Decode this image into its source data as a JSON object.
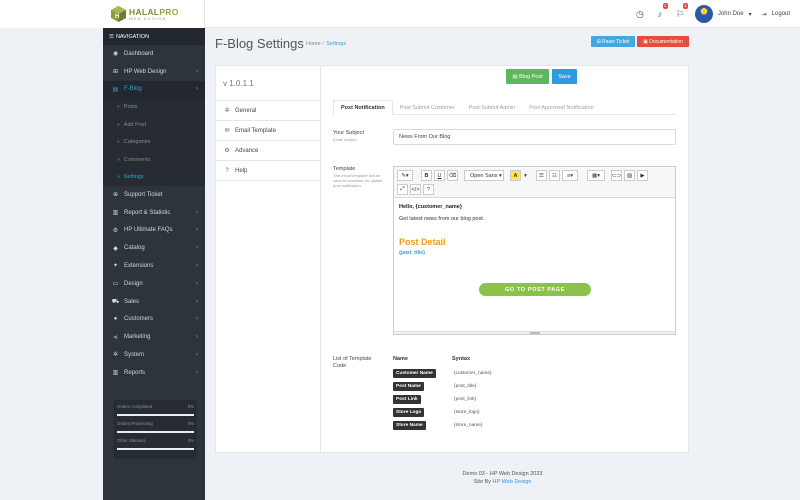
{
  "brand": {
    "name_a": "HALAL",
    "name_b": "PRO",
    "sub": "WEB DESIGN"
  },
  "topbar": {
    "badge1": "3",
    "badge2": "3",
    "user_name": "John Doe",
    "logout": "Logout"
  },
  "sidebar": {
    "heading": "NAVIGATION",
    "items": [
      {
        "label": "Dashboard",
        "icon": "dashboard-icon"
      },
      {
        "label": "HP Web Design",
        "icon": "windows-icon"
      },
      {
        "label": "F-Blog",
        "icon": "blog-icon"
      }
    ],
    "sub_items": [
      "Posts",
      "Add Post",
      "Categories",
      "Comments",
      "Settings"
    ],
    "items2": [
      {
        "label": "Support Ticket"
      },
      {
        "label": "Report & Statistic"
      },
      {
        "label": "HP Ultimate FAQs"
      },
      {
        "label": "Catalog"
      },
      {
        "label": "Extensions"
      },
      {
        "label": "Design"
      },
      {
        "label": "Sales"
      },
      {
        "label": "Customers"
      },
      {
        "label": "Marketing"
      },
      {
        "label": "System"
      },
      {
        "label": "Reports"
      }
    ],
    "stats": [
      {
        "label": "Orders Completed",
        "value": "0%"
      },
      {
        "label": "Orders Processing",
        "value": "0%"
      },
      {
        "label": "Other Statuses",
        "value": "0%"
      }
    ]
  },
  "page": {
    "title": "F-Blog Settings",
    "crumb_home": "Home",
    "crumb_current": "Settings",
    "raise_ticket": "Raise Ticket",
    "documentation": "Documentation"
  },
  "settings": {
    "version": "v 1.0.1.1",
    "left_tabs": [
      "General",
      "Email Template",
      "Advance",
      "Help"
    ],
    "blog_post_btn": "Blog Post",
    "save_btn": "Save",
    "tabs": [
      "Post Notification",
      "Post Submit Customer",
      "Post Submit Admin",
      "Post Approved Notification"
    ],
    "subject_label": "Your Subject",
    "subject_hint": "Email subject",
    "subject_value": "News From Our Blog",
    "template_label": "Template",
    "template_hint": "This email template will be send to customer on update post notification",
    "font_select": "Open Sans",
    "editor": {
      "greeting": "Hello, {customer_name}",
      "line": "Get latest news from our blog post.",
      "post_detail": "Post Detail",
      "post_title": "{post_title}",
      "button": "GO TO POST PAGE"
    },
    "codes_label": "List of Template Code",
    "col_name": "Name",
    "col_syntax": "Syntax",
    "codes": [
      {
        "name": "Customer Name",
        "syntax": "{customer_name}"
      },
      {
        "name": "Post Name",
        "syntax": "{post_title}"
      },
      {
        "name": "Post Link",
        "syntax": "{post_link}"
      },
      {
        "name": "Store Logo",
        "syntax": "{store_logo}"
      },
      {
        "name": "Store Name",
        "syntax": "{store_name}"
      }
    ]
  },
  "footer": {
    "line1": "Demo 03 - HP Web Design 2023",
    "line2_prefix": "Site By",
    "line2_link": "HP Web Design"
  }
}
